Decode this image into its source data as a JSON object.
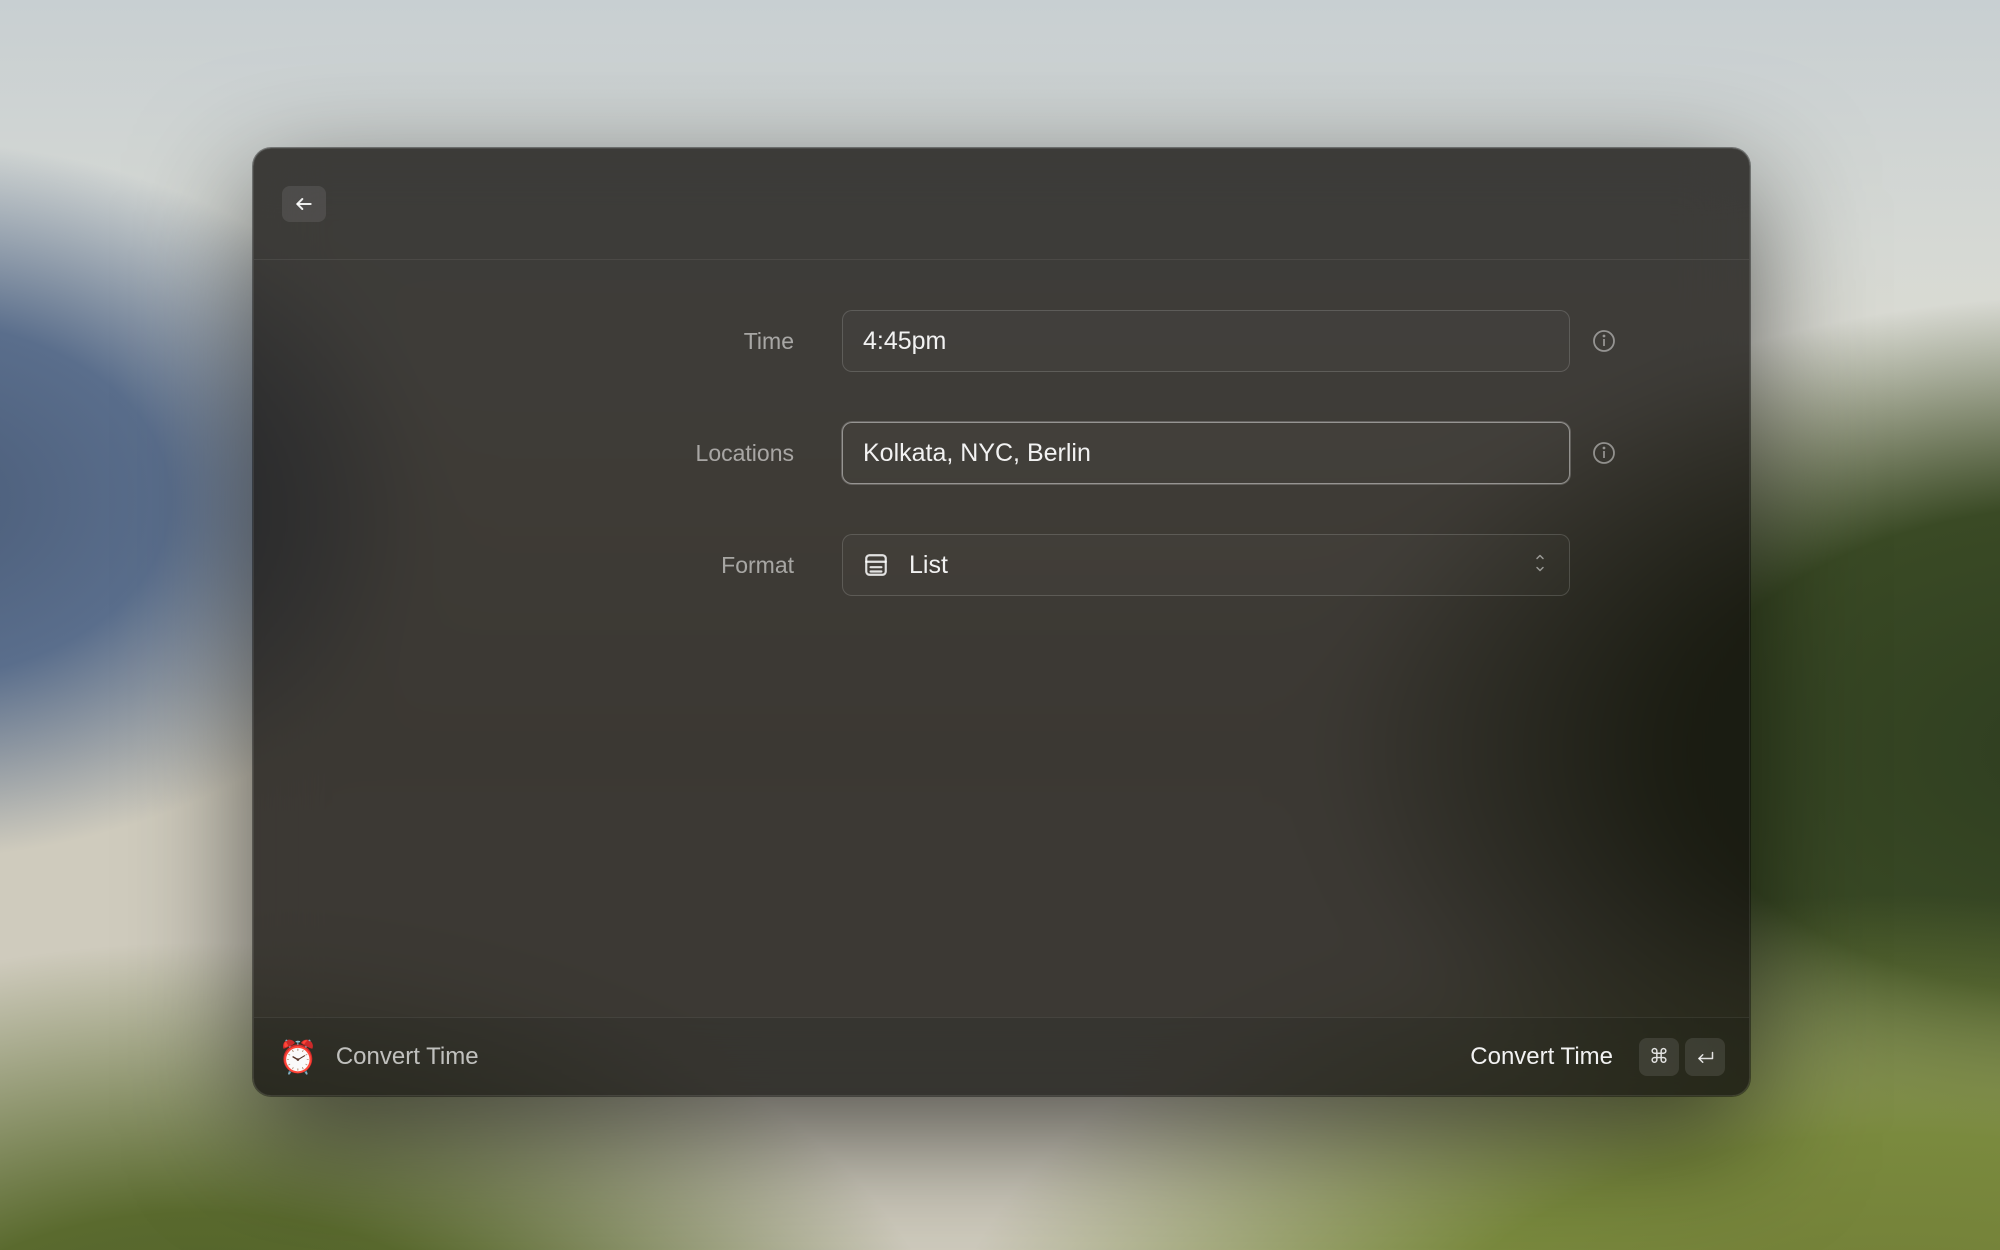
{
  "form": {
    "time": {
      "label": "Time",
      "value": "4:45pm"
    },
    "locations": {
      "label": "Locations",
      "value": "Kolkata, NYC, Berlin"
    },
    "format": {
      "label": "Format",
      "selected": "List"
    }
  },
  "footer": {
    "icon": "⏰",
    "left_title": "Convert Time",
    "action_label": "Convert Time",
    "shortcut_cmd": "⌘",
    "shortcut_enter": "↵"
  }
}
